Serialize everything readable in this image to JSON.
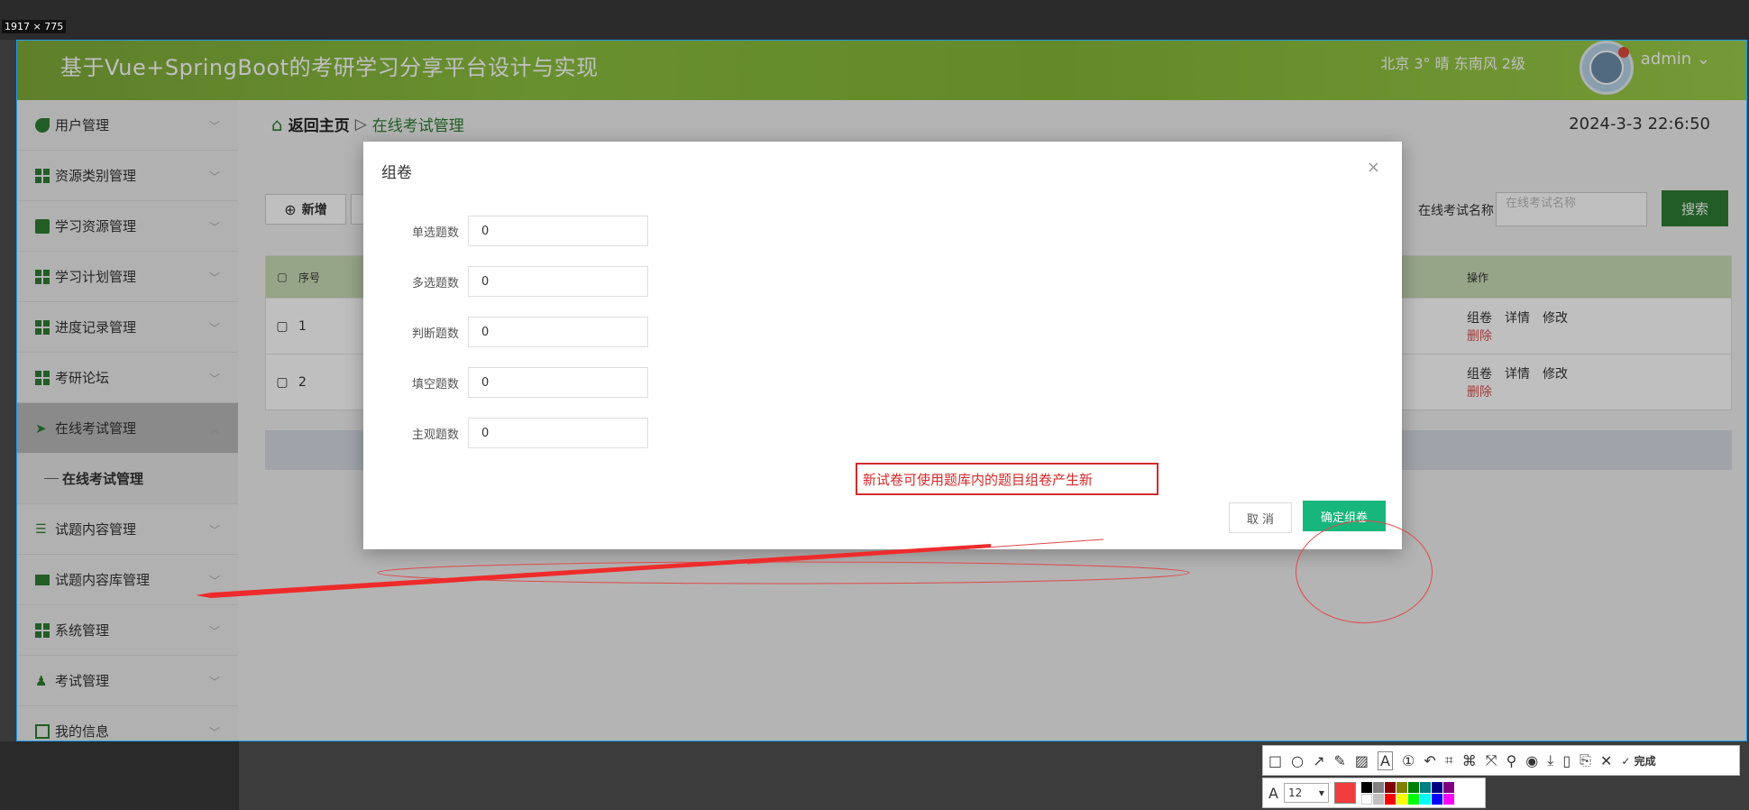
{
  "capture": {
    "size_label": "1917 × 775"
  },
  "header": {
    "title": "基于Vue+SpringBoot的考研学习分享平台设计与实现",
    "weather": "北京 3° 晴 东南风 2级",
    "user": "admin ⌄"
  },
  "sidebar": {
    "items": [
      {
        "label": "用户管理"
      },
      {
        "label": "资源类别管理"
      },
      {
        "label": "学习资源管理"
      },
      {
        "label": "学习计划管理"
      },
      {
        "label": "进度记录管理"
      },
      {
        "label": "考研论坛"
      },
      {
        "label": "在线考试管理"
      },
      {
        "label": "在线考试管理"
      },
      {
        "label": "试题内容管理"
      },
      {
        "label": "试题内容库管理"
      },
      {
        "label": "系统管理"
      },
      {
        "label": "考试管理"
      },
      {
        "label": "我的信息"
      }
    ]
  },
  "breadcrumb": {
    "home": "返回主页",
    "separator": "▷",
    "current": "在线考试管理"
  },
  "datetime": "2024-3-3 22:6:50",
  "toolbar": {
    "add_label": "新增"
  },
  "search": {
    "label": "在线考试名称",
    "placeholder": "在线考试名称",
    "button": "搜索"
  },
  "table": {
    "headers": [
      "序号",
      "操作"
    ],
    "rows": [
      {
        "index": "1",
        "ops": [
          "组卷",
          "详情",
          "修改",
          "删除"
        ]
      },
      {
        "index": "2",
        "ops": [
          "组卷",
          "详情",
          "修改",
          "删除"
        ]
      }
    ]
  },
  "modal": {
    "title": "组卷",
    "close": "×",
    "fields": [
      {
        "label": "单选题数",
        "value": "0"
      },
      {
        "label": "多选题数",
        "value": "0"
      },
      {
        "label": "判断题数",
        "value": "0"
      },
      {
        "label": "填空题数",
        "value": "0"
      },
      {
        "label": "主观题数",
        "value": "0"
      }
    ],
    "cancel": "取 消",
    "confirm": "确定组卷"
  },
  "annotation": {
    "note": "新试卷可使用题库内的题目组卷产生新"
  },
  "tool": {
    "font_size": "12",
    "done": "✓ 完成",
    "current_color": "#f03c3c"
  }
}
